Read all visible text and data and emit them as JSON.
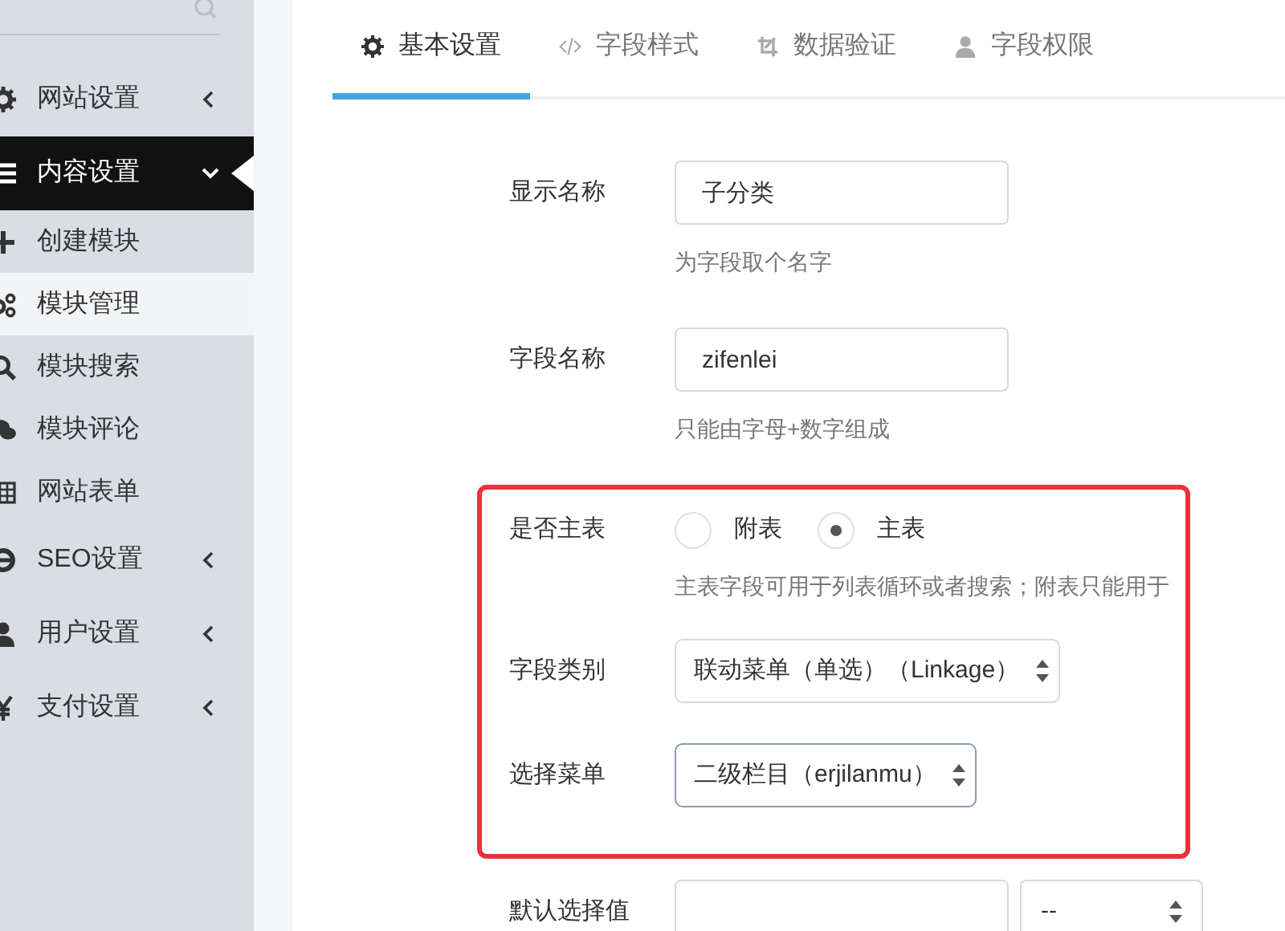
{
  "sidebar": {
    "items": [
      {
        "label": "网站设置",
        "selected": false,
        "expanded": false,
        "kind": "menu"
      },
      {
        "label": "内容设置",
        "selected": true,
        "expanded": true,
        "kind": "menu"
      },
      {
        "label": "创建模块",
        "selected": false,
        "kind": "sub"
      },
      {
        "label": "模块管理",
        "selected": true,
        "kind": "sub"
      },
      {
        "label": "模块搜索",
        "selected": false,
        "kind": "sub"
      },
      {
        "label": "模块评论",
        "selected": false,
        "kind": "sub"
      },
      {
        "label": "网站表单",
        "selected": false,
        "kind": "sub"
      },
      {
        "label": "SEO设置",
        "selected": false,
        "expanded": false,
        "kind": "menu"
      },
      {
        "label": "用户设置",
        "selected": false,
        "expanded": false,
        "kind": "menu"
      },
      {
        "label": "支付设置",
        "selected": false,
        "expanded": false,
        "kind": "menu"
      }
    ]
  },
  "tabs": [
    {
      "label": "基本设置",
      "selected": true
    },
    {
      "label": "字段样式",
      "selected": false
    },
    {
      "label": "数据验证",
      "selected": false
    },
    {
      "label": "字段权限",
      "selected": false
    }
  ],
  "form": {
    "fields": [
      {
        "kind": "input",
        "label": "显示名称",
        "value": "子分类",
        "help": "为字段取个名字"
      },
      {
        "kind": "input",
        "label": "字段名称",
        "value": "zifenlei",
        "help": "只能由字母+数字组成"
      },
      {
        "kind": "radio",
        "label": "是否主表",
        "options": [
          {
            "label": "附表",
            "selected": false
          },
          {
            "label": "主表",
            "selected": true
          }
        ],
        "help": "主表字段可用于列表循环或者搜索；附表只能用于"
      },
      {
        "kind": "select",
        "label": "字段类别",
        "value": "联动菜单（单选）（Linkage）"
      },
      {
        "kind": "select",
        "label": "选择菜单",
        "value": "二级栏目（erjilanmu）",
        "focused": true
      },
      {
        "kind": "input_select",
        "label": "默认选择值",
        "select_value": "--"
      }
    ]
  }
}
